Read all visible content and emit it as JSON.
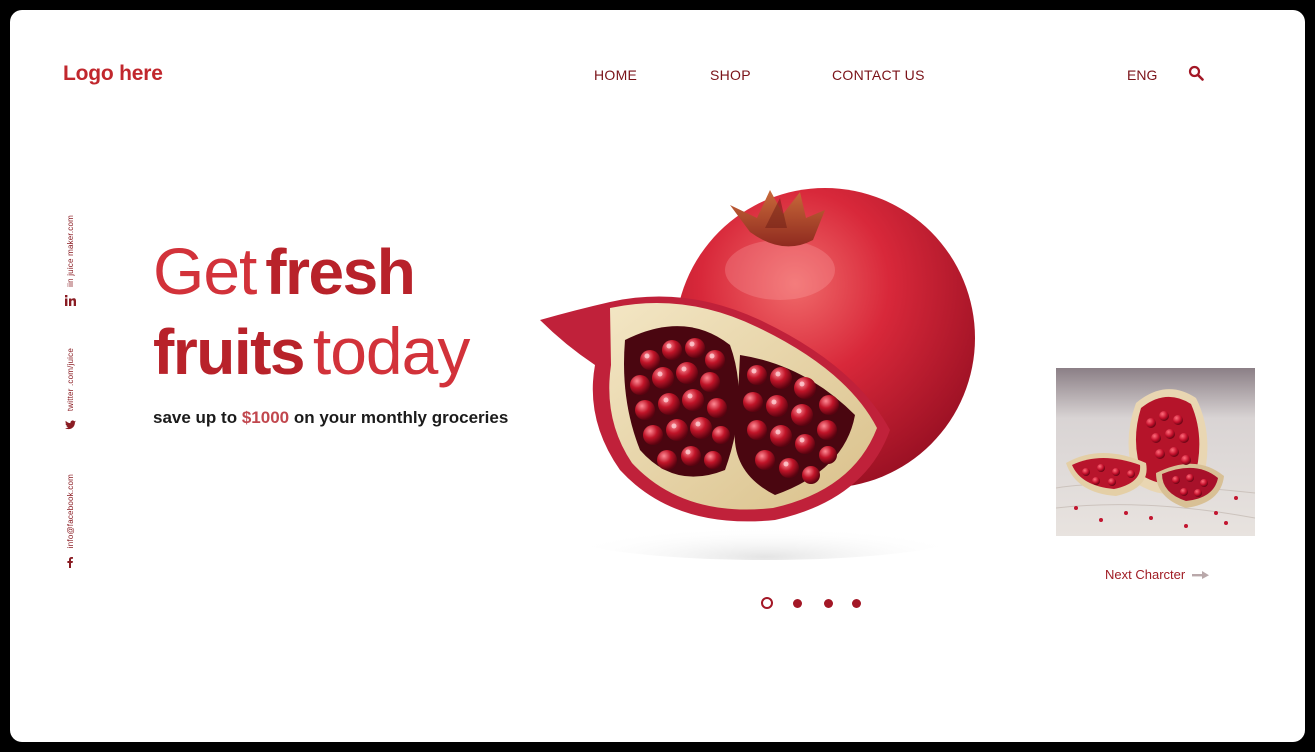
{
  "header": {
    "logo": "Logo here",
    "nav": [
      "HOME",
      "SHOP",
      "CONTACT US"
    ],
    "language": "ENG"
  },
  "socials": {
    "linkedin": "iin juice maker.com",
    "twitter": "twitter .com/juice",
    "facebook": "info@facebook.com"
  },
  "hero": {
    "line1_light": "Get",
    "line1_bold": "fresh",
    "line2_bold": "fruits",
    "line2_light": "today",
    "sub_prefix": "save up to",
    "sub_amount": "$1000",
    "sub_suffix": "on your monthly groceries"
  },
  "carousel": {
    "next_label": "Next Charcter",
    "slides": 4,
    "active_index": 0
  },
  "colors": {
    "brand": "#c1272d",
    "nav": "#7a1218",
    "dot": "#a31726"
  },
  "icons": [
    "search-icon",
    "linkedin-icon",
    "twitter-icon",
    "facebook-icon",
    "arrow-right-icon"
  ]
}
